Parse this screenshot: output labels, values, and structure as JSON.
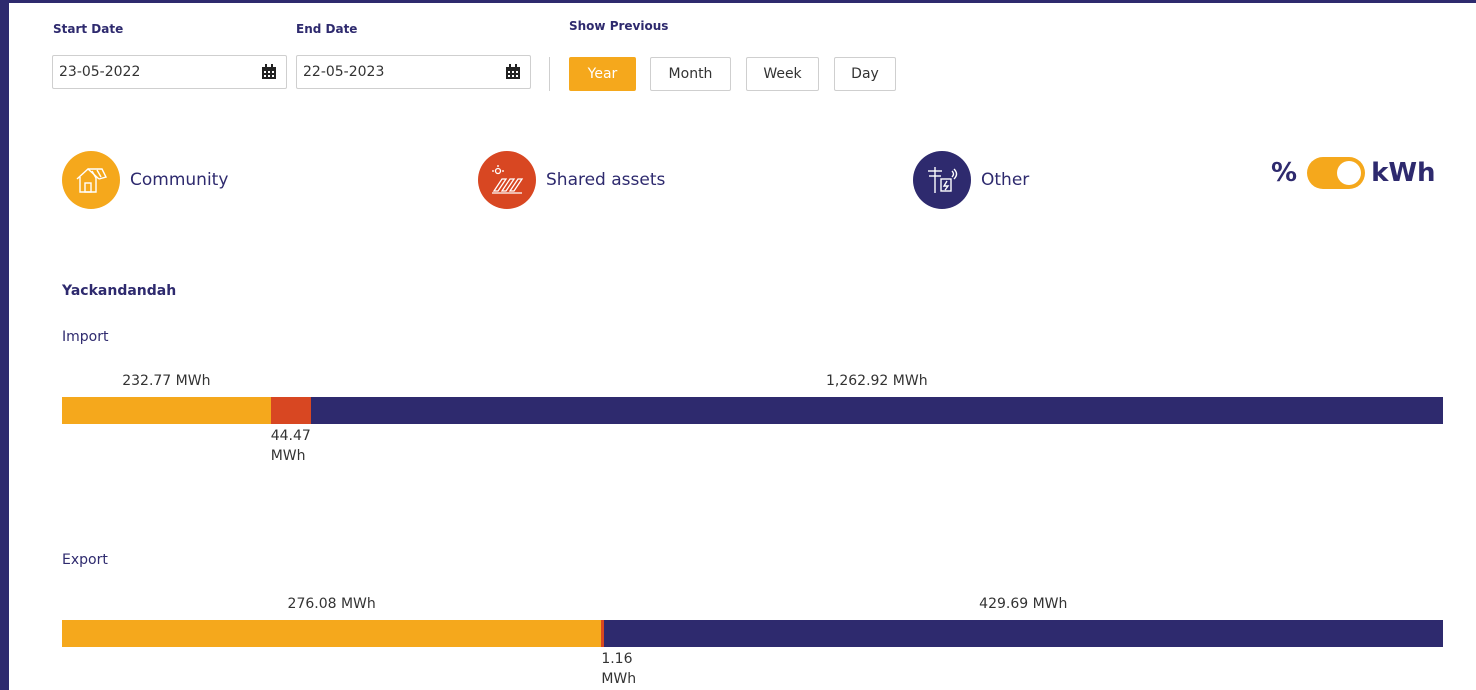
{
  "filters": {
    "start_label": "Start Date",
    "end_label": "End Date",
    "show_previous_label": "Show Previous",
    "start_value": "23-05-2022",
    "end_value": "22-05-2023",
    "periods": [
      {
        "label": "Year",
        "active": true
      },
      {
        "label": "Month",
        "active": false
      },
      {
        "label": "Week",
        "active": false
      },
      {
        "label": "Day",
        "active": false
      }
    ]
  },
  "legend": [
    {
      "label": "Community",
      "color": "#f5a81c",
      "icon": "house-solar-icon"
    },
    {
      "label": "Shared assets",
      "color": "#d84722",
      "icon": "solar-panels-icon"
    },
    {
      "label": "Other",
      "color": "#2e2a6e",
      "icon": "utility-pole-icon"
    }
  ],
  "unit_toggle": {
    "left": "%",
    "right": "kWh",
    "selected": "kWh"
  },
  "site": {
    "name": "Yackandandah",
    "import": {
      "label": "Import",
      "segments": [
        {
          "name": "Community",
          "value": 232.77,
          "label": "232.77 MWh",
          "color": "#f5a81c"
        },
        {
          "name": "Shared assets",
          "value": 44.47,
          "label_line1": "44.47",
          "label_line2": "MWh",
          "color": "#d84722"
        },
        {
          "name": "Other",
          "value": 1262.92,
          "label": "1,262.92 MWh",
          "color": "#2e2a6e"
        }
      ]
    },
    "export": {
      "label": "Export",
      "segments": [
        {
          "name": "Community",
          "value": 276.08,
          "label": "276.08 MWh",
          "color": "#f5a81c"
        },
        {
          "name": "Shared assets",
          "value": 1.16,
          "label_line1": "1.16",
          "label_line2": "MWh",
          "color": "#d84722"
        },
        {
          "name": "Other",
          "value": 429.69,
          "label": "429.69 MWh",
          "color": "#2e2a6e"
        }
      ]
    }
  }
}
